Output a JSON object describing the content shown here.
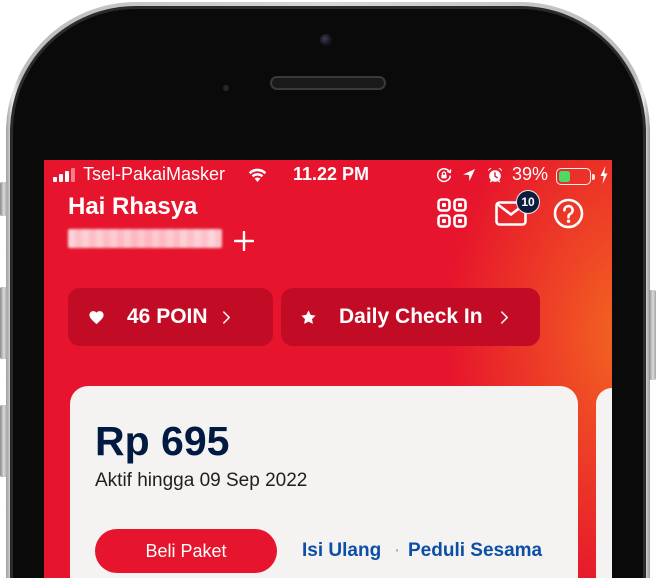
{
  "status_bar": {
    "carrier": "Tsel-PakaiMasker",
    "time": "11.22 PM",
    "battery_percent": "39%",
    "battery_level": 0.39,
    "icons": [
      "signal-icon",
      "wifi-icon",
      "orientation-lock-icon",
      "location-icon",
      "alarm-icon",
      "battery-icon",
      "charging-icon"
    ]
  },
  "header": {
    "greeting": "Hai Rhasya",
    "inbox_badge": "10",
    "icons": [
      "plus-icon",
      "qr-code-icon",
      "mail-icon",
      "help-icon"
    ]
  },
  "shortcuts": [
    {
      "label": "46 POIN",
      "icon": "heart-icon"
    },
    {
      "label": "Daily Check In",
      "icon": "star-icon"
    }
  ],
  "balance_card": {
    "balance": "Rp 695",
    "active_until": "Aktif hingga 09 Sep 2022",
    "buy_button": "Beli Paket",
    "links": [
      "Isi Ulang",
      "Peduli Sesama"
    ],
    "separator": "·"
  },
  "colors": {
    "brand_red": "#e6142c",
    "accent_orange": "#f36b21",
    "pill_red": "#c20c26",
    "balance_navy": "#001a41",
    "link_blue": "#0b4fa6",
    "badge_navy": "#0d1b3e",
    "battery_green": "#4cd964",
    "card_background": "#f4f3f1"
  }
}
